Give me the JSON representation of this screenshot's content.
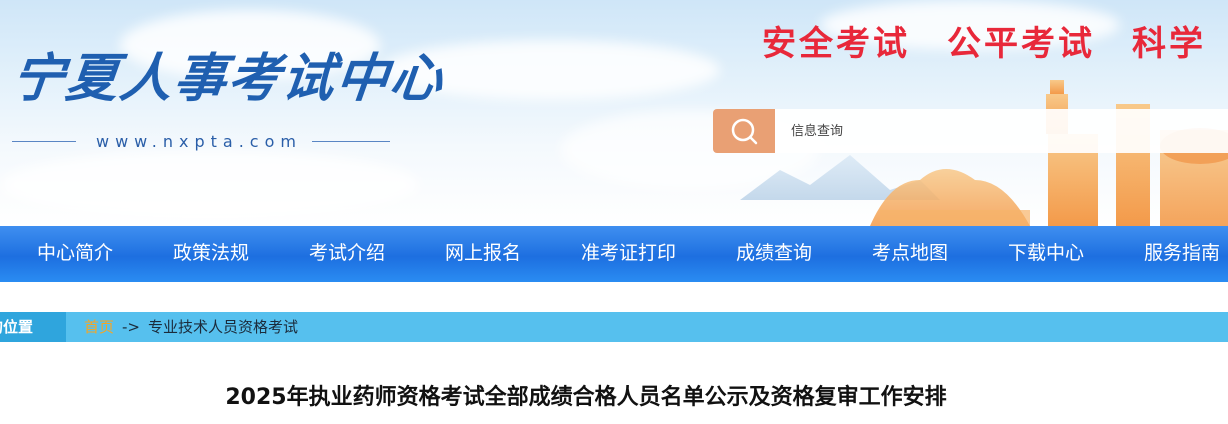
{
  "header": {
    "logo_title": "宁夏人事考试中心",
    "logo_url": "www.nxpta.com",
    "slogan": "安全考试　公平考试　科学",
    "search": {
      "placeholder": "信息查询",
      "button_icon": "search-icon"
    }
  },
  "nav": {
    "items": [
      {
        "label": "中心简介"
      },
      {
        "label": "政策法规"
      },
      {
        "label": "考试介绍"
      },
      {
        "label": "网上报名"
      },
      {
        "label": "准考证打印"
      },
      {
        "label": "成绩查询"
      },
      {
        "label": "考点地图"
      },
      {
        "label": "下载中心"
      },
      {
        "label": "服务指南"
      }
    ]
  },
  "breadcrumb": {
    "tag": "的位置",
    "home": "首页",
    "separator": "->",
    "current": "专业技术人员资格考试"
  },
  "article": {
    "title": "2025年执业药师资格考试全部成绩合格人员名单公示及资格复审工作安排"
  },
  "colors": {
    "nav_bg": "#1d6fe0",
    "slogan": "#e8283a",
    "breadcrumb_bg": "#56c0ee",
    "home_link": "#f6a623",
    "search_button": "#e9a074"
  }
}
